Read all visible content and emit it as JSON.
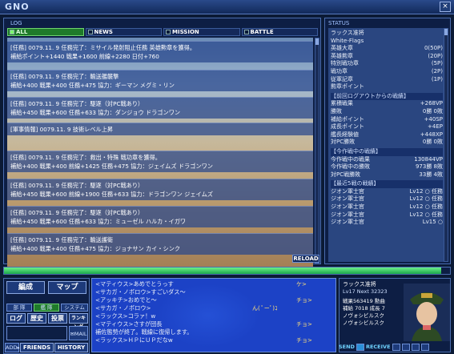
{
  "app": {
    "title": "GNO",
    "close": "×"
  },
  "log": {
    "label": "LOG",
    "tabs": [
      "ALL",
      "NEWS",
      "MISSION",
      "BATTLE"
    ],
    "reload": "RELOAD",
    "entries": [
      {
        "line1": "[任務] 0079.11. 9 任務完了：ミサイル発射阻止任務 英雄勲章を獲得。",
        "line2": "補給ポイント+1440 戦果+1600 前線+2280 日付+760"
      },
      {
        "line1": "[任務] 0079.11. 9 任務完了：輸送艦襲撃",
        "line2": "補給+400 戦果+400 任務+475 協力：ギーマン メグミ・リン"
      },
      {
        "line1": "[任務] 0079.11. 9 任務完了：駆逐（対PC戦あり）",
        "line2": "補給+450 戦果+600 任務+633 協力：ダンジョウ ドラゴンワン"
      },
      {
        "line1": "[軍事情報] 0079.11. 9 技術レベル上昇",
        "line2": ""
      },
      {
        "line1": "[任務] 0079.11. 9 任務完了：救出・特殊 戦功章を獲得。",
        "line2": "補給+400 戦果+400 前線+1425 任務+475 協力：ジェイムズ ドラゴンワン"
      },
      {
        "line1": "[任務] 0079.11. 9 任務完了：駆逐（対PC戦あり）",
        "line2": "補給+450 戦果+600 前線+1900 任務+633 協力：ドラゴンワン ジェイムズ"
      },
      {
        "line1": "[任務] 0079.11. 9 任務完了：駆逐（対PC戦あり）",
        "line2": "補給+450 戦果+600 任務+633 協力：ミューゼル ハルカ・イガワ"
      },
      {
        "line1": "[任務] 0079.11. 9 任務完了：輸送護衛",
        "line2": "補給+400 戦果+400 任務+475 協力：ジョナサン カイ・シンク"
      }
    ]
  },
  "status": {
    "label": "STATUS",
    "name": "ラックス准将",
    "unit": "White-Flags",
    "medals": [
      {
        "k": "英雄大章",
        "v": "0(50P)"
      },
      {
        "k": "英雄勲章",
        "v": "(20P)"
      },
      {
        "k": "特別戦功章",
        "v": "(5P)"
      },
      {
        "k": "戦功章",
        "v": "(2P)"
      },
      {
        "k": "従軍記章",
        "v": "(1P)"
      },
      {
        "k": "勲章ポイント",
        "v": ""
      }
    ],
    "sec1": "【前回ログアウトからの戦績】",
    "rows1": [
      {
        "k": "累積戦果",
        "v": "+268VP"
      },
      {
        "k": "勝敗",
        "v": "0勝 0敗"
      },
      {
        "k": "補給ポイント",
        "v": "+40SP"
      },
      {
        "k": "成長ポイント",
        "v": "+4EP"
      },
      {
        "k": "艦長経験値",
        "v": "+448XP"
      },
      {
        "k": "対PC勝敗",
        "v": "0勝 0敗"
      }
    ],
    "sec2": "【今作戦中の戦績】",
    "rows2": [
      {
        "k": "今作戦中の戦果",
        "v": "130844VP"
      },
      {
        "k": "今作戦中の勝敗",
        "v": "973勝 8敗"
      },
      {
        "k": "対PC戦勝敗",
        "v": "33勝 4敗"
      }
    ],
    "sec3": "【最近5戦の戦績】",
    "rows3": [
      {
        "k": "ジオン軍士官",
        "v": "Lv12 ○ 任務"
      },
      {
        "k": "ジオン軍士官",
        "v": "Lv12 ○ 任務"
      },
      {
        "k": "ジオン軍士官",
        "v": "Lv12 ○ 任務"
      },
      {
        "k": "ジオン軍士官",
        "v": "Lv12 ○ 任務"
      },
      {
        "k": "ジオン軍士官",
        "v": "Lv15 ○"
      }
    ]
  },
  "hp": {
    "fraction": 0.98
  },
  "menu": {
    "hensei": "編成",
    "map": "マップ",
    "buka": "部 隊",
    "kantai": "艦 隊",
    "system": "システム",
    "log": "ログ",
    "rekishi": "歴史",
    "touhyou": "投票",
    "ranking": "ランキング",
    "mail": "MAIL",
    "add": "ADD▸",
    "friends": "FRIENDS",
    "history": "HISTORY"
  },
  "chat": {
    "messages": [
      "<マティウス>あめでとうっす",
      "<サカガ・ノボロウ>すごいダス〜",
      "<アッキチ>おめでと〜",
      "<サカガ・ノボロウ>",
      "<ラックス>コラァ！w",
      "<マティウス>さすが団長",
      "補佐態勢が終了。戦線に復帰します。",
      "<ラックス>ＨＰにＵＰだなw"
    ],
    "side": [
      "ケ>",
      "チョ>",
      "ん( ﾟーﾟ)ｺ",
      "チョ>",
      "チョ>"
    ]
  },
  "player": {
    "name": "ラックス准将",
    "lvl": "Lv17 Next 32323",
    "stats": [
      "戦果563419 勲曲",
      "補給 7018 成長 7",
      "ノヴォシビルスク",
      "ノヴォシビルスク"
    ],
    "send": "SEND",
    "receive": "RECEIVE"
  }
}
